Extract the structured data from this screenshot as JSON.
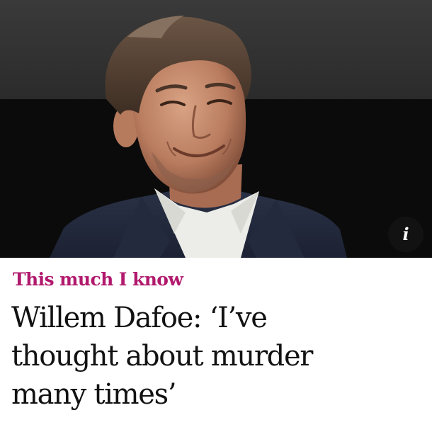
{
  "hero": {
    "photo_subject": "smiling-man-portrait",
    "info_button_glyph": "i"
  },
  "article": {
    "kicker": "This much I know",
    "headline_lines": [
      "Willem Dafoe: ‘I’ve",
      "thought about murder",
      "many times’"
    ]
  },
  "colors": {
    "kicker": "#b1196d",
    "headline": "#121212",
    "photo_background": "#0a0a0a",
    "info_button": "#121212"
  }
}
